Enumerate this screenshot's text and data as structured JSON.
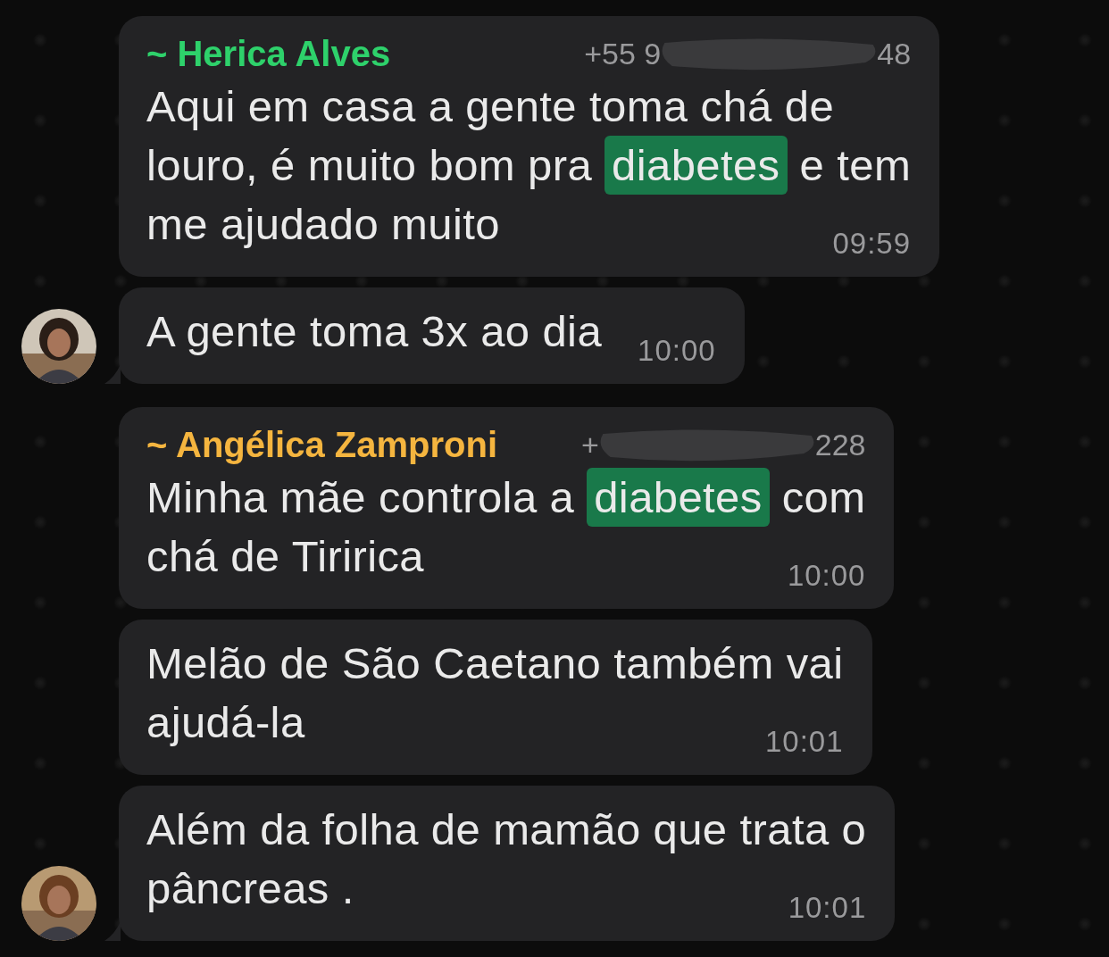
{
  "messages": [
    {
      "sender": {
        "name": "~ Herica Alves",
        "color": "#2ed16b",
        "phone_start": "+55 9",
        "phone_end": "48"
      },
      "lines": [
        [
          {
            "text": "Aqui em casa a gente toma chá de",
            "highlighted": false
          }
        ],
        [
          {
            "text": "louro, é muito bom pra ",
            "highlighted": false
          },
          {
            "text": "diabetes",
            "highlighted": true
          },
          {
            "text": " e tem",
            "highlighted": false
          }
        ],
        [
          {
            "text": "me ajudado muito",
            "highlighted": false
          }
        ]
      ],
      "time": "09:59",
      "avatar": false
    },
    {
      "lines": [
        [
          {
            "text": "A gente toma 3x ao dia",
            "highlighted": false
          }
        ]
      ],
      "time": "10:00",
      "avatar": true
    },
    {
      "sender": {
        "name": "~ Angélica Zamproni",
        "color": "#f5b53f",
        "phone_start": "+",
        "phone_end": "228"
      },
      "lines": [
        [
          {
            "text": "Minha mãe controla a ",
            "highlighted": false
          },
          {
            "text": "diabetes",
            "highlighted": true
          },
          {
            "text": " com",
            "highlighted": false
          }
        ],
        [
          {
            "text": "chá de Tiririca",
            "highlighted": false
          }
        ]
      ],
      "time": "10:00",
      "avatar": false
    },
    {
      "lines": [
        [
          {
            "text": "Melão de São Caetano também vai",
            "highlighted": false
          }
        ],
        [
          {
            "text": "ajudá-la",
            "highlighted": false
          }
        ]
      ],
      "time": "10:01",
      "avatar": false
    },
    {
      "lines": [
        [
          {
            "text": "Além da folha de mamão que trata o",
            "highlighted": false
          }
        ],
        [
          {
            "text": "pâncreas .",
            "highlighted": false
          }
        ]
      ],
      "time": "10:01",
      "avatar": true
    }
  ]
}
